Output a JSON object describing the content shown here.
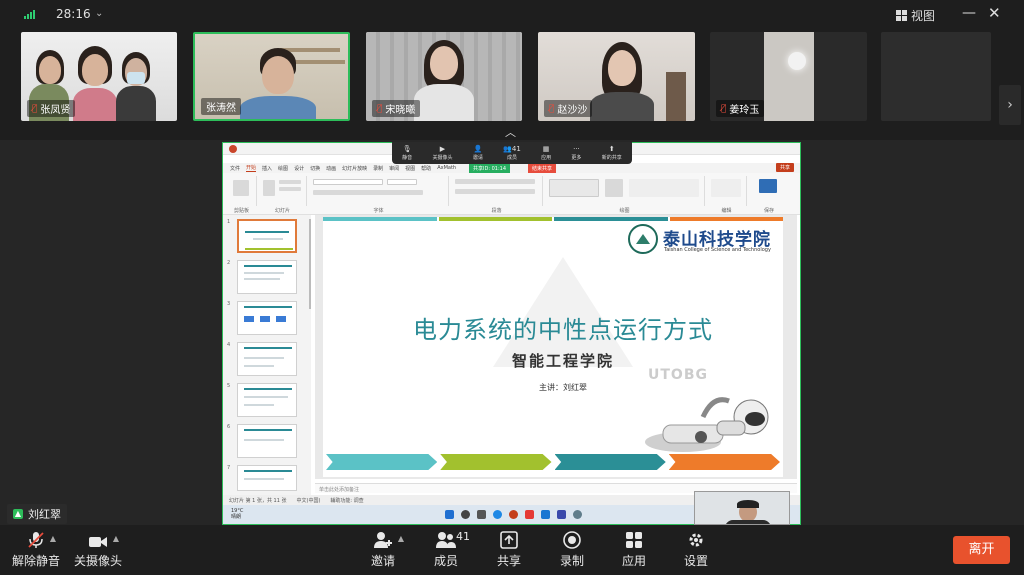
{
  "top": {
    "timer": "28:16",
    "view_label": "视图"
  },
  "participants": [
    {
      "name": "张凤贤",
      "muted": true
    },
    {
      "name": "张涛然",
      "muted": false
    },
    {
      "name": "宋晓曦",
      "muted": true
    },
    {
      "name": "赵沙沙",
      "muted": true
    },
    {
      "name": "姜玲玉",
      "muted": true
    }
  ],
  "share_toolbar": {
    "items": [
      "静音",
      "关摄像头",
      "邀请",
      "成员",
      "应用",
      "更多",
      "新的共享"
    ],
    "members_count": "41"
  },
  "ppt": {
    "title": "SAAPT — 电力系统的中性点运行方式",
    "menu": [
      "文件",
      "开始",
      "插入",
      "绘图",
      "设计",
      "切换",
      "动画",
      "幻灯片放映",
      "录制",
      "审阅",
      "视图",
      "帮助",
      "AxMath"
    ],
    "active_menu": "开始",
    "share_btn": "共享",
    "sharing_tag": "共享ID: 01:14",
    "stop_tag": "结束共享",
    "ribbon_groups": [
      "剪贴板",
      "幻灯片",
      "字体",
      "段落",
      "绘图",
      "编辑",
      "保存"
    ],
    "thumb_numbers": [
      "1",
      "2",
      "3",
      "4",
      "5",
      "6",
      "7"
    ],
    "notes_placeholder": "单击此处添加备注",
    "status_left": "幻灯片 第 1 张，共 11 张",
    "status_lang": "中文(中国)",
    "status_access": "辅助功能: 调查",
    "weather_temp": "19°C",
    "weather_desc": "晴朗"
  },
  "slide": {
    "school_name": "泰山科技学院",
    "school_en": "Taishan College of Science and Technology",
    "title": "电力系统的中性点运行方式",
    "subtitle": "智能工程学院",
    "lecturer": "主讲：刘红翠",
    "watermark": "UTOBG",
    "bar_colors": [
      "#5bc2c6",
      "#a2c12e",
      "#2b8f96",
      "#ee7b2a"
    ]
  },
  "speaker": {
    "name": "刘红翠"
  },
  "toolbar": {
    "unmute": "解除静音",
    "camera": "关摄像头",
    "invite": "邀请",
    "members": "成员",
    "members_count": "41",
    "share": "共享",
    "record": "录制",
    "apps": "应用",
    "settings": "设置",
    "leave": "离开"
  },
  "colors": {
    "leave": "#e8522d",
    "active_speaker": "#2dbd5a",
    "slide_title": "#2a8a95"
  }
}
